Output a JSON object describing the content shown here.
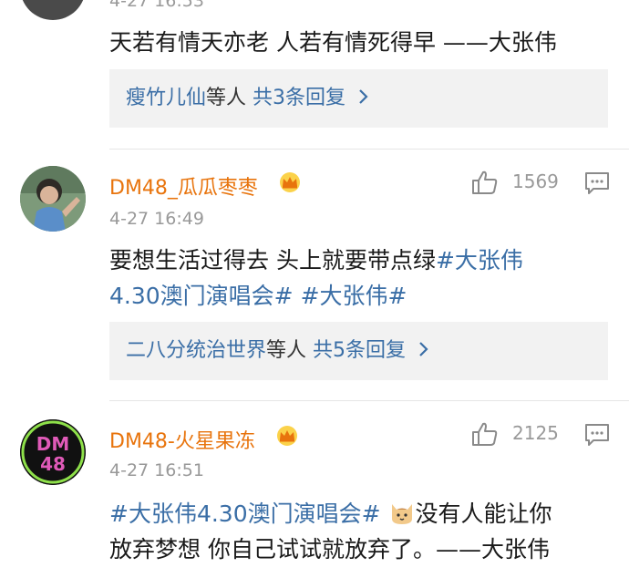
{
  "comments": [
    {
      "time": "4-27 16:53",
      "text": "天若有情天亦老 人若有情死得早 ——大张伟",
      "reply": {
        "names": "瘦竹儿仙",
        "mid": "等人",
        "count": "共3条回复"
      }
    },
    {
      "username": "DM48_瓜瓜枣枣",
      "time": "4-27 16:49",
      "likes": "1569",
      "text_line1_plain": "要想生活过得去 头上就要带点绿",
      "text_line1_tag": "#大张伟",
      "text_line2_tag1": "4.30澳门演唱会#",
      "text_line2_tag2": "#大张伟#",
      "reply": {
        "names": "二八分统治世界",
        "mid": "等人",
        "count": "共5条回复"
      }
    },
    {
      "username": "DM48-火星果冻",
      "time": "4-27 16:51",
      "likes": "2125",
      "avatar_text": "DM48",
      "text_line1_tag": "#大张伟4.30澳门演唱会#",
      "text_line1_plain": "没有人能让你",
      "text_line2_plain": "放弃梦想  你自己试试就放弃了。——大张伟"
    }
  ],
  "colors": {
    "username": "#e8740d",
    "link": "#3a6ea6",
    "muted": "#999999",
    "reply_bg": "#f2f2f2"
  },
  "icons": [
    "like-icon",
    "comment-icon",
    "crown-icon",
    "chevron-right-icon",
    "cat-emoji-icon"
  ]
}
